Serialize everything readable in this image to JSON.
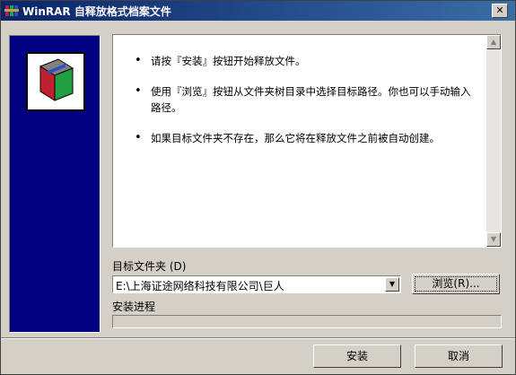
{
  "window": {
    "title": "WinRAR 自释放格式档案文件",
    "close_glyph": "✕"
  },
  "info": {
    "items": [
      "请按『安装』按钮开始释放文件。",
      "使用『浏览』按钮从文件夹树目录中选择目标路径。你也可以手动输入路径。",
      "如果目标文件夹不存在，那么它将在释放文件之前被自动创建。"
    ]
  },
  "dest": {
    "label": "目标文件夹 (D)",
    "path": "E:\\上海证途网络科技有限公司\\巨人",
    "browse_label": "浏览(R)..."
  },
  "progress": {
    "label": "安装进程",
    "value": 0
  },
  "buttons": {
    "install": "安装",
    "cancel": "取消"
  }
}
